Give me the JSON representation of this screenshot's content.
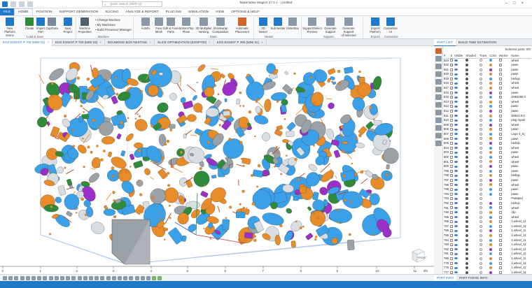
{
  "window": {
    "title": "Materialise Magics 27.0.1 - Untitled",
    "search_placeholder": "Quick search (Shift+Q)"
  },
  "ribbon_tabs": [
    "FILE",
    "HOME",
    "POSITION",
    "SUPPORT GENERATION",
    "SLICING",
    "ANALYZE & REPORT",
    "PLUG INS",
    "SIMULATION",
    "VIEW",
    "OPTIONS & HELP"
  ],
  "ribbon": {
    "buttons": [
      {
        "label": "New Platform",
        "sub": "Scene",
        "name": "new-platform-button"
      },
      {
        "label": "Create",
        "sub": "",
        "name": "create-button"
      },
      {
        "label": "Import",
        "sub": "Part",
        "name": "import-part-button"
      },
      {
        "label": "Cap/Data",
        "sub": "",
        "name": "capdata-button"
      },
      {
        "label": "Save",
        "sub": "Project",
        "name": "save-project-button"
      },
      {
        "label": "Machine",
        "sub": "Properties",
        "name": "machine-properties-button"
      },
      {
        "label": "Autofix",
        "sub": "",
        "name": "autofix-button"
      },
      {
        "label": "Fuse",
        "sub": "Mesh",
        "name": "fuse-mesh-button"
      },
      {
        "label": "Edit & Fuse",
        "sub": "Parts",
        "name": "edit-fuse-parts-button"
      },
      {
        "label": "Bottom/Top",
        "sub": "Plane",
        "name": "bottom-top-plane-button"
      },
      {
        "label": "3D Multiplier",
        "sub": "Nesting",
        "name": "3d-multiplier-button"
      },
      {
        "label": "Shrinkwrap",
        "sub": "Composition",
        "name": "shrinkwrap-button"
      },
      {
        "label": "Automatic",
        "sub": "Placement",
        "name": "automatic-placement-button"
      },
      {
        "label": "3D",
        "sub": "Nester",
        "name": "3d-nester-button"
      },
      {
        "label": "Sub Nester",
        "sub": "",
        "name": "sub-nester-button"
      },
      {
        "label": "SinterBox",
        "sub": "",
        "name": "sinterbox-button"
      },
      {
        "label": "Support/Select",
        "sub": "Preview",
        "name": "support-preview-button"
      },
      {
        "label": "Generate",
        "sub": "Support",
        "name": "generate-support-button"
      },
      {
        "label": "Generate Support",
        "sub": "of Selected",
        "name": "generate-support-selected-button"
      },
      {
        "label": "Export",
        "sub": "Platform",
        "name": "export-platform-button"
      },
      {
        "label": "Customize",
        "sub": "UI",
        "name": "customize-ui-button"
      }
    ],
    "machine_menu": [
      "Change Machine",
      "My Machines",
      "Build Processor Manager"
    ],
    "groups": [
      "Load & Save",
      "Machine",
      "Basic",
      "Nester",
      "Support",
      "Export",
      "Customize"
    ]
  },
  "doc_tabs": [
    {
      "label": "EOS EOSINT P 700 (MINI 01)",
      "active": true
    },
    {
      "label": "EOS EOSINT P 700 (MINI 02)",
      "active": false
    },
    {
      "label": "BOUNDING BOX NESTING",
      "active": false
    },
    {
      "label": "SLICE OPTIMIZATION (EOSP700)",
      "active": false
    },
    {
      "label": "EOS EOSINT P 395 (MINI 01)",
      "active": false
    }
  ],
  "right_tabs": {
    "active": "PART LIST",
    "other": "BUILD TIME ESTIMATION"
  },
  "part_list": {
    "selected_text": "Selected parts: 0/0",
    "headers": [
      "#",
      "S",
      "Visible",
      "Shaded",
      "Trans",
      "Color",
      "Interior",
      "Name"
    ],
    "rows": [
      {
        "id": "823",
        "color": "#3aa0e8",
        "name": "wheel"
      },
      {
        "id": "822",
        "color": "#e88c2a",
        "name": "pawn"
      },
      {
        "id": "821",
        "color": "#9b30c8",
        "name": "pawn"
      },
      {
        "id": "820",
        "color": "#e88c2a",
        "name": "pawn"
      },
      {
        "id": "819",
        "color": "#3aa0e8",
        "name": "bishop"
      },
      {
        "id": "818",
        "color": "#e88c2a",
        "name": "wheel"
      },
      {
        "id": "817",
        "color": "#e88c2a",
        "name": "wheel"
      },
      {
        "id": "816",
        "color": "#9b30c8",
        "name": "pawn"
      },
      {
        "id": "815",
        "color": "#3aa0e8",
        "name": "D962286.0"
      },
      {
        "id": "814",
        "color": "#e88c2a",
        "name": "wheel"
      },
      {
        "id": "813",
        "color": "#3aa0e8",
        "name": "pawn"
      },
      {
        "id": "812",
        "color": "#9b30c8",
        "name": "pawn"
      },
      {
        "id": "811",
        "color": "#e88c2a",
        "name": "D9623.0.0"
      },
      {
        "id": "810",
        "color": "#3aa0e8",
        "name": "plug repair"
      },
      {
        "id": "809",
        "color": "#9b30c8",
        "name": "wheel"
      },
      {
        "id": "808",
        "color": "#e88c2a",
        "name": "pawn"
      },
      {
        "id": "807",
        "color": "#3aa0e8",
        "name": "Logo 4_st_"
      },
      {
        "id": "806",
        "color": "#e88c2a",
        "name": "pawn"
      },
      {
        "id": "805",
        "color": "#9b30c8",
        "name": "bishop"
      },
      {
        "id": "804",
        "color": "#3aa0e8",
        "name": "wheel"
      },
      {
        "id": "803",
        "color": "#e88c2a",
        "name": "pawn"
      },
      {
        "id": "802",
        "color": "#3aa0e8",
        "name": "wheel"
      },
      {
        "id": "801",
        "color": "#e88c2a",
        "name": "wheel"
      },
      {
        "id": "800",
        "color": "#9b30c8",
        "name": "pawn"
      },
      {
        "id": "799",
        "color": "#3aa0e8",
        "name": "pawn"
      },
      {
        "id": "798",
        "color": "#e88c2a",
        "name": "bishop"
      },
      {
        "id": "797",
        "color": "#9b30c8",
        "name": "pawn"
      },
      {
        "id": "796",
        "color": "#e88c2a",
        "name": "wheel"
      },
      {
        "id": "795",
        "color": "#3aa0e8",
        "name": "pawn"
      },
      {
        "id": "794",
        "color": "#3aa0e8",
        "name": "pawn"
      },
      {
        "id": "793",
        "color": "#f4f4f4",
        "name": "Passpod"
      },
      {
        "id": "792",
        "color": "#9b30c8",
        "name": "bishop"
      },
      {
        "id": "791",
        "color": "#3aa0e8",
        "name": "wheel"
      },
      {
        "id": "790",
        "color": "#e88c2a",
        "name": "clip"
      },
      {
        "id": "789",
        "color": "#3aa0e8",
        "name": "wheel"
      },
      {
        "id": "788",
        "color": "#e88c2a",
        "name": "1.wheel_11"
      },
      {
        "id": "787",
        "color": "#3aa0e8",
        "name": "1.wheel_11"
      },
      {
        "id": "786",
        "color": "#9b30c8",
        "name": "1.wheel_11"
      },
      {
        "id": "785",
        "color": "#e88c2a",
        "name": "1.wheel_11"
      },
      {
        "id": "784",
        "color": "#3aa0e8",
        "name": "1.wheel_11"
      },
      {
        "id": "783",
        "color": "#e88c2a",
        "name": "1.wheel_11"
      },
      {
        "id": "782",
        "color": "#9b30c8",
        "name": "1.wheel_11"
      },
      {
        "id": "781",
        "color": "#3aa0e8",
        "name": "1.wheel_11"
      },
      {
        "id": "780",
        "color": "#e88c2a",
        "name": "1.wheel_11"
      },
      {
        "id": "779",
        "color": "#3aa0e8",
        "name": "1.wheel_11"
      },
      {
        "id": "778",
        "color": "#e88c2a",
        "name": "1.wheel_11"
      },
      {
        "id": "777",
        "color": "#9b30c8",
        "name": "1.wheel_11"
      }
    ]
  },
  "bottom_tabs": {
    "active": "PART INFO",
    "other": "PART FIXING INFO"
  },
  "ruler": {
    "ticks": [
      "0",
      "1",
      "2",
      "3",
      "4",
      "5",
      "6",
      "7",
      "8",
      "9",
      "10",
      "11"
    ],
    "unit": "dm"
  },
  "view_cube": {
    "label": "FRONT"
  },
  "colors": {
    "accent": "#1f78c8",
    "blue_part": "#3aa0e8",
    "orange_part": "#e88c2a",
    "purple_part": "#9b30c8",
    "green_part": "#2f8a3a",
    "support": "#b04020"
  }
}
